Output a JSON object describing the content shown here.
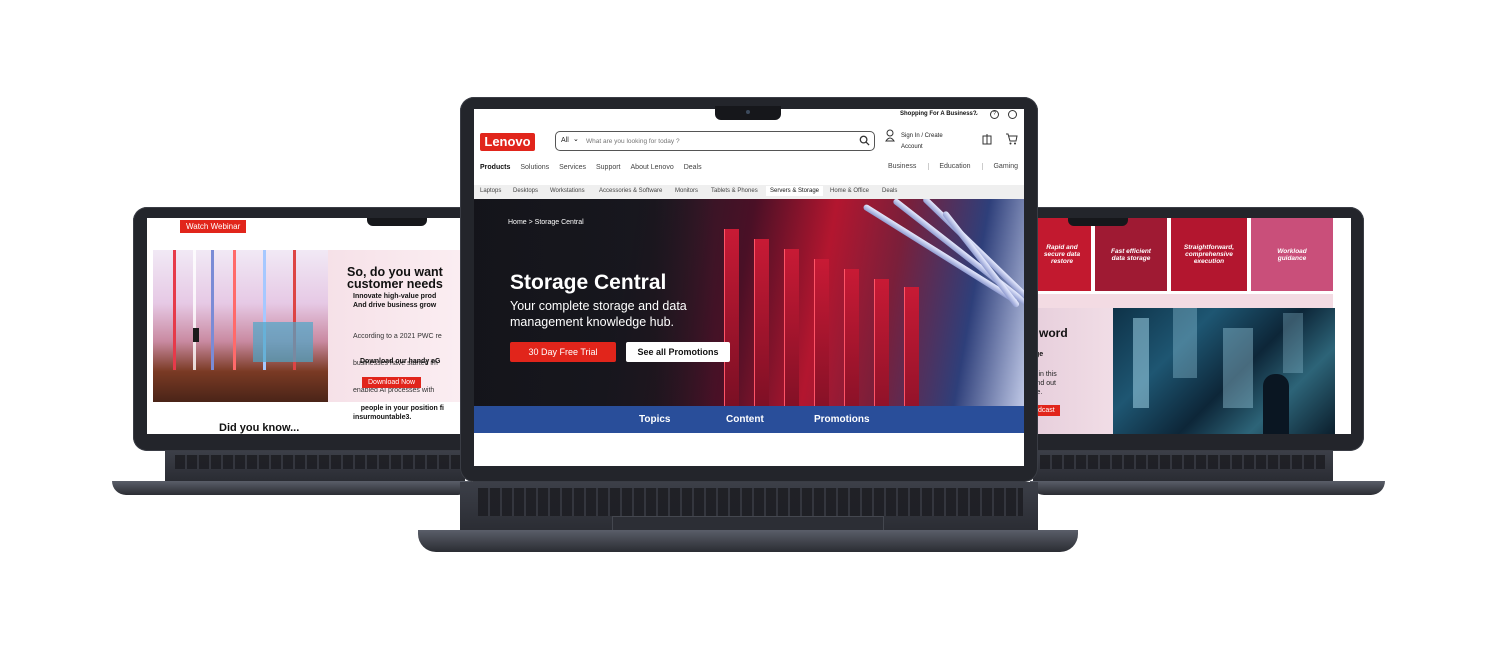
{
  "left": {
    "webinar_button": "Watch Webinar",
    "title": "So, do you want\ncustomer needs",
    "subtitle": "Innovate high-value prod\nAnd drive business grow",
    "body_lines": [
      "According to a 2021 PWC re",
      "businesses have started im",
      "enabled AI processes with"
    ],
    "body_bold": "people in your position fi\ninsurmountable3.",
    "download_text": "Download our handy eG",
    "download_button": "Download Now",
    "did_you_know": "Did you know..."
  },
  "right": {
    "tiles": [
      {
        "label": "Rapid and\nsecure data\nrestore",
        "color": "#c2192f"
      },
      {
        "label": "Fast efficient\ndata storage",
        "color": "#9f1a33"
      },
      {
        "label": "Straightforward,\ncomprehensive\nexecution",
        "color": "#b3162f"
      },
      {
        "label": "Workload\nguidance",
        "color": "#c94f7a"
      }
    ],
    "word_fragment": "word",
    "ge_fragment": "ge",
    "text_fragment": "y in this\nfind out\nce.",
    "button_fragment": "dcast"
  },
  "center": {
    "utility": {
      "business_link": "Shopping For A Business?"
    },
    "logo": "Lenovo",
    "search": {
      "category": "All",
      "placeholder": "What are you looking for today ?"
    },
    "account": "Sign In / Create\nAccount",
    "nav": [
      "Products",
      "Solutions",
      "Services",
      "Support",
      "About Lenovo",
      "Deals"
    ],
    "nav_right": [
      "Business",
      "Education",
      "Gaming"
    ],
    "subnav": [
      "Laptops",
      "Desktops",
      "Workstations",
      "Accessories & Software",
      "Monitors",
      "Tablets & Phones",
      "Servers & Storage",
      "Home & Office",
      "Deals"
    ],
    "hero": {
      "breadcrumb": "Home > Storage Central",
      "title": "Storage Central",
      "subtitle": "Your complete storage and data\nmanagement knowledge hub.",
      "primary_button": "30 Day Free Trial",
      "secondary_button": "See all Promotions"
    },
    "tabs": [
      "Topics",
      "Content",
      "Promotions"
    ],
    "colors": {
      "brand_red": "#e1251b",
      "tab_blue": "#294e9a"
    }
  }
}
